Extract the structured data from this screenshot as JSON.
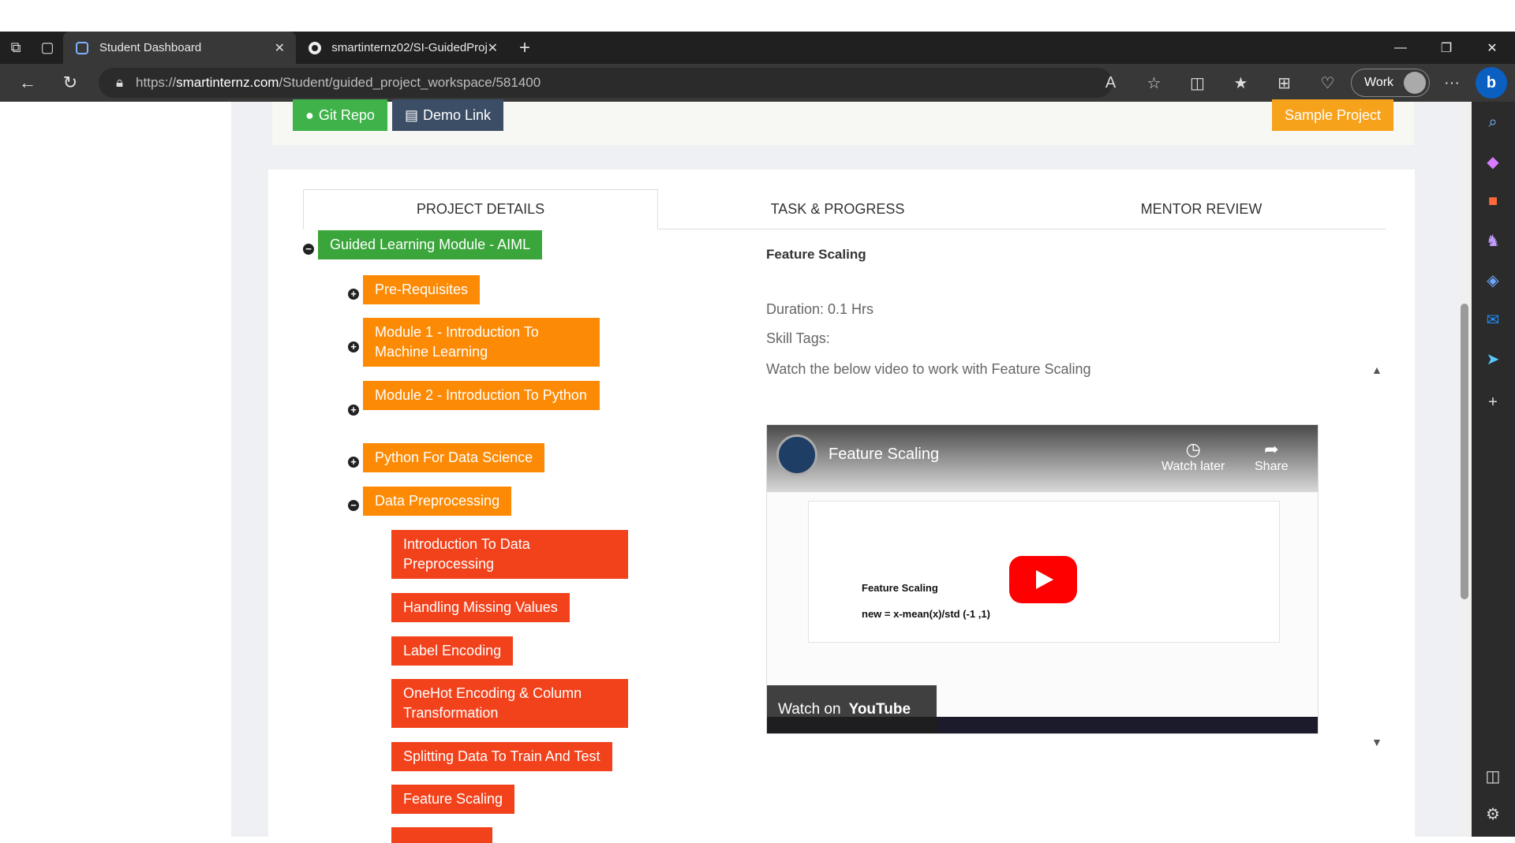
{
  "browser": {
    "tabs": [
      {
        "title": "Student Dashboard",
        "active": true
      },
      {
        "title": "smartinternz02/SI-GuidedProject",
        "active": false
      }
    ],
    "url_prefix": "https://",
    "url_host": "smartinternz.com",
    "url_path": "/Student/guided_project_workspace/581400",
    "profile_label": "Work",
    "bing_label": "b"
  },
  "toolbar": {
    "git_label": "Git Repo",
    "demo_label": "Demo Link",
    "sample_label": "Sample Project"
  },
  "project_tabs": [
    {
      "label": "PROJECT DETAILS",
      "active": true
    },
    {
      "label": "TASK & PROGRESS",
      "active": false
    },
    {
      "label": "MENTOR REVIEW",
      "active": false
    }
  ],
  "tree": {
    "root": "Guided Learning Module - AIML",
    "modules": [
      {
        "label": "Pre-Requisites",
        "expanded": false
      },
      {
        "label": "Module 1 - Introduction To Machine Learning",
        "expanded": false
      },
      {
        "label": "Module 2 - Introduction To Python",
        "expanded": false
      },
      {
        "label": "Python For Data Science",
        "expanded": false
      },
      {
        "label": "Data Preprocessing",
        "expanded": true
      }
    ],
    "lessons": [
      "Introduction To Data Preprocessing",
      "Handling Missing Values",
      "Label Encoding",
      "OneHot Encoding & Column Transformation",
      "Splitting Data To Train And Test",
      "Feature Scaling"
    ]
  },
  "detail": {
    "title": "Feature Scaling",
    "duration": "Duration: 0.1 Hrs",
    "skill_tags": "Skill Tags:",
    "instruction": "Watch the below video to work with Feature Scaling"
  },
  "video": {
    "title": "Feature Scaling",
    "watch_later": "Watch later",
    "share": "Share",
    "heading": "Feature Scaling",
    "formula": "new = x-mean(x)/std (-1 ,1)",
    "watch_on": "Watch on",
    "youtube": "YouTube"
  },
  "colors": {
    "green": "#3aa53a",
    "orange": "#fd8a04",
    "red": "#f2421c",
    "dark_blue": "#3c4e66",
    "amber": "#f6a21a"
  }
}
